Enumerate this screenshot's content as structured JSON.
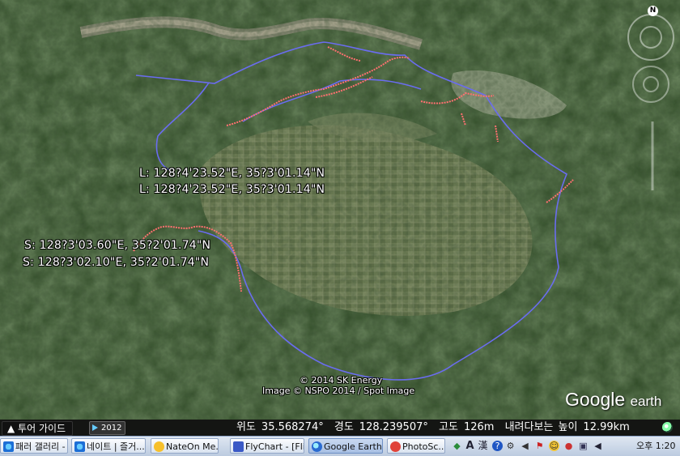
{
  "map": {
    "labels": {
      "l_start": "L: 128?4'23.52\"E, 35?3'01.14\"N",
      "l_end": "L: 128?4'23.52\"E, 35?3'01.14\"N",
      "s_start": "S: 128?3'03.60\"E, 35?2'01.74\"N",
      "s_end": "S: 128?3'02.10\"E, 35?2'01.74\"N"
    },
    "credits": {
      "line1": "© 2014 SK Energy",
      "line2": "Image © NSPO 2014 / Spot Image"
    },
    "logo": {
      "brand": "Google",
      "product": "earth"
    },
    "compass": {
      "north_label": "N"
    },
    "colors": {
      "track_blue": "#6a6cf0",
      "track_red": "#ff7070",
      "terrain": "#2f4a26"
    }
  },
  "statusbar": {
    "tour_label": "▲ 투어 가이드",
    "year": "2012",
    "lat_label": "위도",
    "lat_value": "35.568274°",
    "lon_label": "경도",
    "lon_value": "128.239507°",
    "alt_label": "고도",
    "alt_value": "126m",
    "eye_label": "내려다보는 높이",
    "eye_value": "12.99km"
  },
  "taskbar": {
    "items": [
      {
        "label": "패러 갤러리 - ...",
        "icon": "ie-icon"
      },
      {
        "label": "네이트 | 즐거...",
        "icon": "ie-icon"
      },
      {
        "label": "NateOn Me...",
        "icon": "nateon-icon"
      },
      {
        "label": "FlyChart - [Fli...",
        "icon": "flychart-icon"
      },
      {
        "label": "Google Earth",
        "icon": "google-earth-icon"
      },
      {
        "label": "PhotoSc...",
        "icon": "photoscape-icon"
      }
    ],
    "tray": {
      "ime_a": "A",
      "ime_han": "漢"
    },
    "clock": "오후 1:20"
  }
}
